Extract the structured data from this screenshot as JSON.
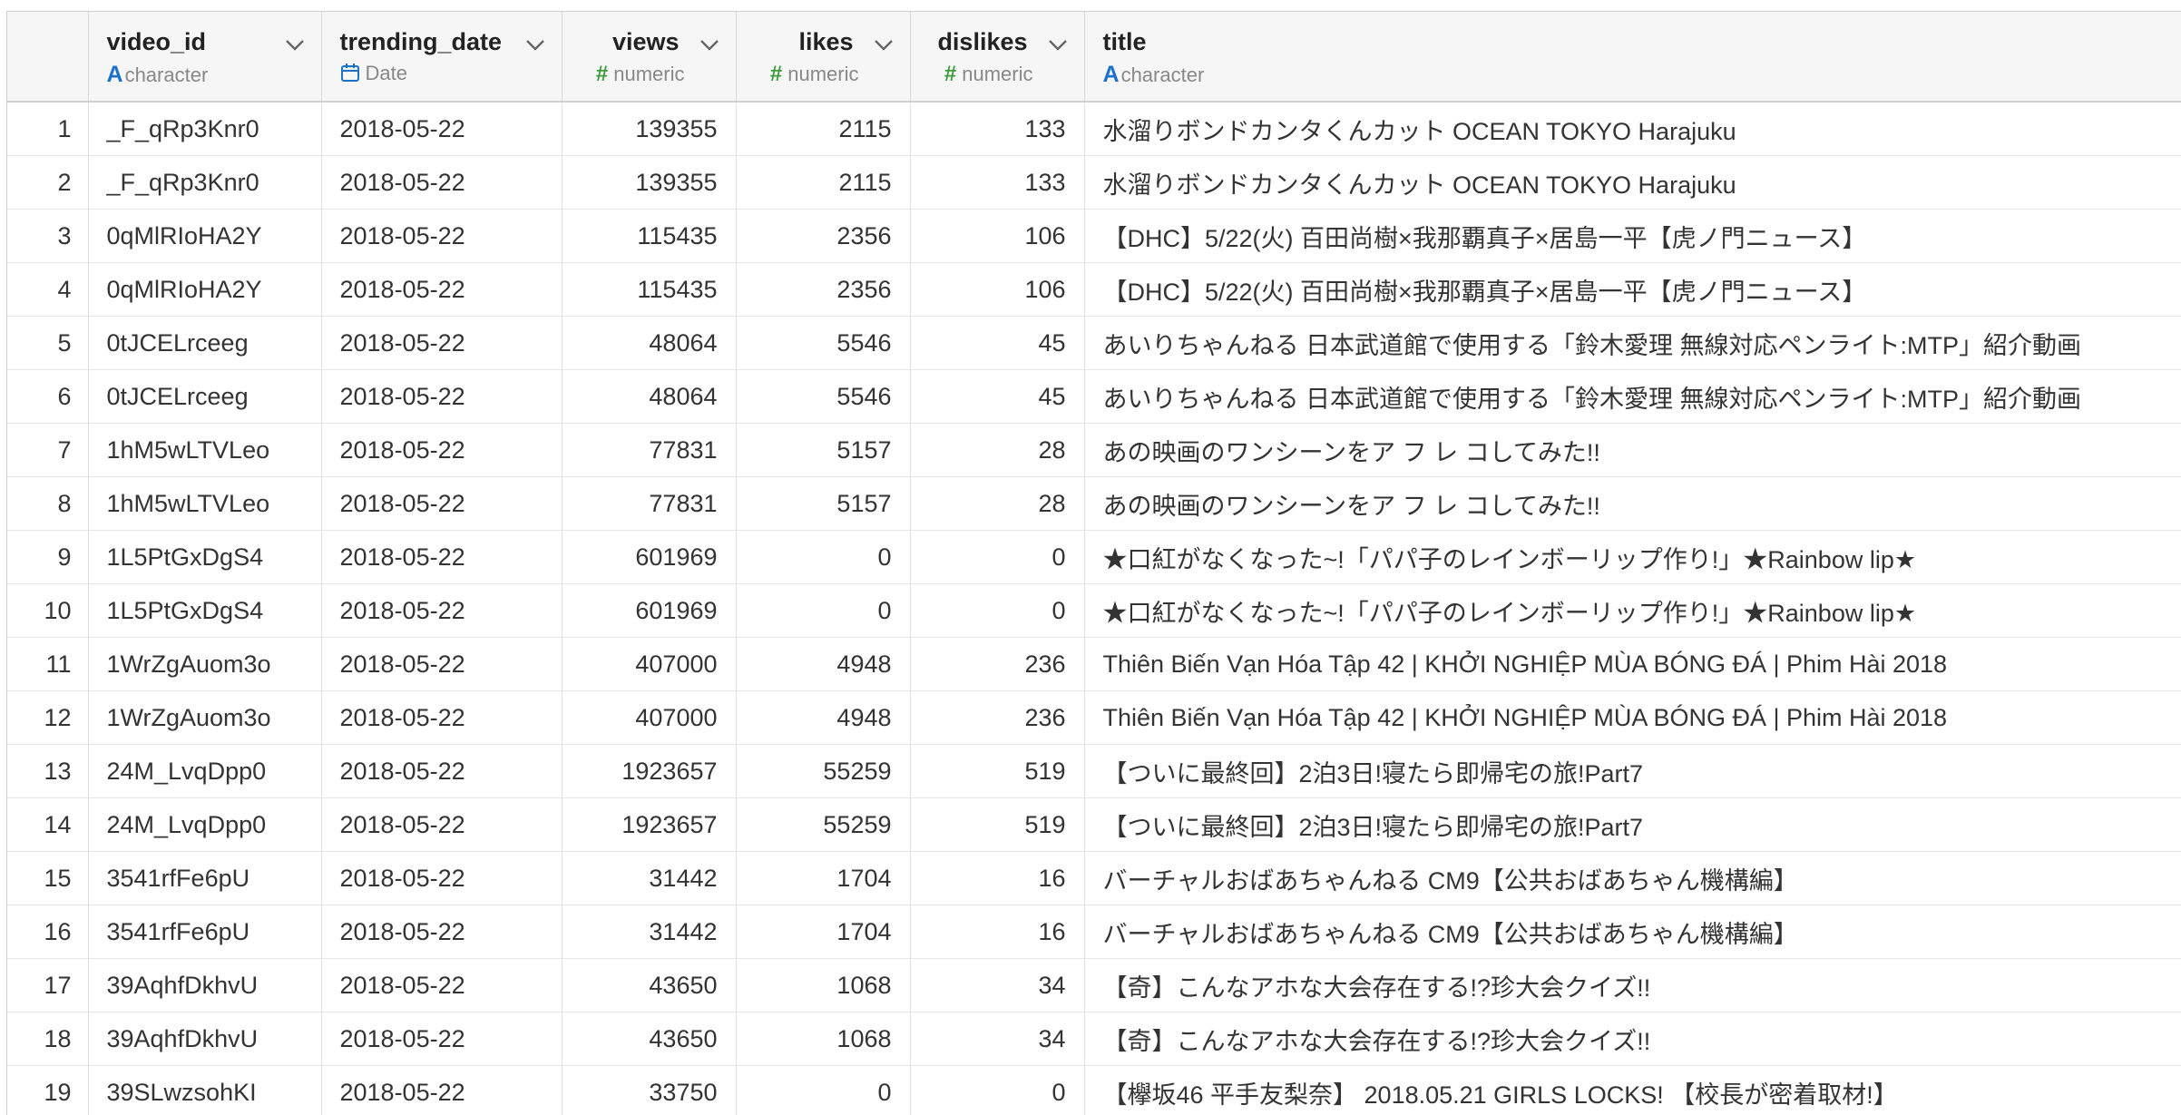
{
  "columns": [
    {
      "name": "video_id",
      "type": "character",
      "type_icon": "character-type-icon"
    },
    {
      "name": "trending_date",
      "type": "Date",
      "type_icon": "calendar-icon"
    },
    {
      "name": "views",
      "type": "numeric",
      "type_icon": "hash-icon"
    },
    {
      "name": "likes",
      "type": "numeric",
      "type_icon": "hash-icon"
    },
    {
      "name": "dislikes",
      "type": "numeric",
      "type_icon": "hash-icon"
    },
    {
      "name": "title",
      "type": "character",
      "type_icon": "character-type-icon"
    }
  ],
  "icons": {
    "column_menu": "chevron-down-icon"
  },
  "colors": {
    "character_icon": "#1a73c8",
    "numeric_icon": "#3a9a3a",
    "date_icon": "#1a73c8"
  },
  "rows": [
    {
      "idx": "1",
      "video_id": "_F_qRp3Knr0",
      "trending_date": "2018-05-22",
      "views": "139355",
      "likes": "2115",
      "dislikes": "133",
      "title": "水溜りボンドカンタくんカット OCEAN TOKYO Harajuku"
    },
    {
      "idx": "2",
      "video_id": "_F_qRp3Knr0",
      "trending_date": "2018-05-22",
      "views": "139355",
      "likes": "2115",
      "dislikes": "133",
      "title": "水溜りボンドカンタくんカット OCEAN TOKYO Harajuku"
    },
    {
      "idx": "3",
      "video_id": "0qMlRIoHA2Y",
      "trending_date": "2018-05-22",
      "views": "115435",
      "likes": "2356",
      "dislikes": "106",
      "title": "【DHC】5/22(火) 百田尚樹×我那覇真子×居島一平【虎ノ門ニュース】"
    },
    {
      "idx": "4",
      "video_id": "0qMlRIoHA2Y",
      "trending_date": "2018-05-22",
      "views": "115435",
      "likes": "2356",
      "dislikes": "106",
      "title": "【DHC】5/22(火) 百田尚樹×我那覇真子×居島一平【虎ノ門ニュース】"
    },
    {
      "idx": "5",
      "video_id": "0tJCELrceeg",
      "trending_date": "2018-05-22",
      "views": "48064",
      "likes": "5546",
      "dislikes": "45",
      "title": "あいりちゃんねる 日本武道館で使用する「鈴木愛理 無線対応ペンライト:MTP」紹介動画"
    },
    {
      "idx": "6",
      "video_id": "0tJCELrceeg",
      "trending_date": "2018-05-22",
      "views": "48064",
      "likes": "5546",
      "dislikes": "45",
      "title": "あいりちゃんねる 日本武道館で使用する「鈴木愛理 無線対応ペンライト:MTP」紹介動画"
    },
    {
      "idx": "7",
      "video_id": "1hM5wLTVLeo",
      "trending_date": "2018-05-22",
      "views": "77831",
      "likes": "5157",
      "dislikes": "28",
      "title": "あの映画のワンシーンをア フ レ コしてみた!!"
    },
    {
      "idx": "8",
      "video_id": "1hM5wLTVLeo",
      "trending_date": "2018-05-22",
      "views": "77831",
      "likes": "5157",
      "dislikes": "28",
      "title": "あの映画のワンシーンをア フ レ コしてみた!!"
    },
    {
      "idx": "9",
      "video_id": "1L5PtGxDgS4",
      "trending_date": "2018-05-22",
      "views": "601969",
      "likes": "0",
      "dislikes": "0",
      "title": "★口紅がなくなった~!「パパ子のレインボーリップ作り!」★Rainbow lip★"
    },
    {
      "idx": "10",
      "video_id": "1L5PtGxDgS4",
      "trending_date": "2018-05-22",
      "views": "601969",
      "likes": "0",
      "dislikes": "0",
      "title": "★口紅がなくなった~!「パパ子のレインボーリップ作り!」★Rainbow lip★"
    },
    {
      "idx": "11",
      "video_id": "1WrZgAuom3o",
      "trending_date": "2018-05-22",
      "views": "407000",
      "likes": "4948",
      "dislikes": "236",
      "title": "Thiên Biến Vạn Hóa Tập 42 | KHỞI NGHIỆP MÙA BÓNG ĐÁ | Phim Hài 2018"
    },
    {
      "idx": "12",
      "video_id": "1WrZgAuom3o",
      "trending_date": "2018-05-22",
      "views": "407000",
      "likes": "4948",
      "dislikes": "236",
      "title": "Thiên Biến Vạn Hóa Tập 42 | KHỞI NGHIỆP MÙA BÓNG ĐÁ | Phim Hài 2018"
    },
    {
      "idx": "13",
      "video_id": "24M_LvqDpp0",
      "trending_date": "2018-05-22",
      "views": "1923657",
      "likes": "55259",
      "dislikes": "519",
      "title": "【ついに最終回】2泊3日!寝たら即帰宅の旅!Part7"
    },
    {
      "idx": "14",
      "video_id": "24M_LvqDpp0",
      "trending_date": "2018-05-22",
      "views": "1923657",
      "likes": "55259",
      "dislikes": "519",
      "title": "【ついに最終回】2泊3日!寝たら即帰宅の旅!Part7"
    },
    {
      "idx": "15",
      "video_id": "3541rfFe6pU",
      "trending_date": "2018-05-22",
      "views": "31442",
      "likes": "1704",
      "dislikes": "16",
      "title": "バーチャルおばあちゃんねる CM9【公共おばあちゃん機構編】"
    },
    {
      "idx": "16",
      "video_id": "3541rfFe6pU",
      "trending_date": "2018-05-22",
      "views": "31442",
      "likes": "1704",
      "dislikes": "16",
      "title": "バーチャルおばあちゃんねる CM9【公共おばあちゃん機構編】"
    },
    {
      "idx": "17",
      "video_id": "39AqhfDkhvU",
      "trending_date": "2018-05-22",
      "views": "43650",
      "likes": "1068",
      "dislikes": "34",
      "title": "【奇】こんなアホな大会存在する!?珍大会クイズ!!"
    },
    {
      "idx": "18",
      "video_id": "39AqhfDkhvU",
      "trending_date": "2018-05-22",
      "views": "43650",
      "likes": "1068",
      "dislikes": "34",
      "title": "【奇】こんなアホな大会存在する!?珍大会クイズ!!"
    },
    {
      "idx": "19",
      "video_id": "39SLwzsohKI",
      "trending_date": "2018-05-22",
      "views": "33750",
      "likes": "0",
      "dislikes": "0",
      "title": "【欅坂46 平手友梨奈】 2018.05.21 GIRLS LOCKS! 【校長が密着取材!】"
    }
  ]
}
